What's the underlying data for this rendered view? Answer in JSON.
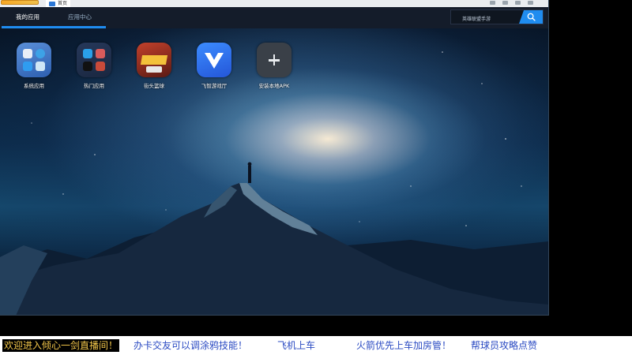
{
  "titlebar": {
    "tab_title": "首页"
  },
  "header": {
    "tabs": [
      {
        "label": "我的应用",
        "active": true
      },
      {
        "label": "应用中心",
        "active": false
      }
    ],
    "search": {
      "placeholder": "英雄联盟手游",
      "icon": "search-icon"
    }
  },
  "apps": [
    {
      "label": "系统应用",
      "icon": "system-apps-folder-icon"
    },
    {
      "label": "热门应用",
      "icon": "popular-apps-folder-icon"
    },
    {
      "label": "街头篮球",
      "icon": "street-basketball-game-icon"
    },
    {
      "label": "飞智游戏厅",
      "icon": "flydigi-game-hall-icon"
    },
    {
      "label": "安装本地APK",
      "icon": "plus-icon"
    }
  ],
  "ticker": {
    "items": [
      "欢迎进入倾心一剑直播间！",
      "办卡交友可以调涂鸦技能！",
      "飞机上车",
      "火箭优先上车加房管！",
      "帮球员攻略点赞"
    ]
  },
  "colors": {
    "accent": "#1f8cf0",
    "header_bg": "#141c2a",
    "ticker_text": "#2a4ac2",
    "welcome_text": "#f2c64a"
  }
}
